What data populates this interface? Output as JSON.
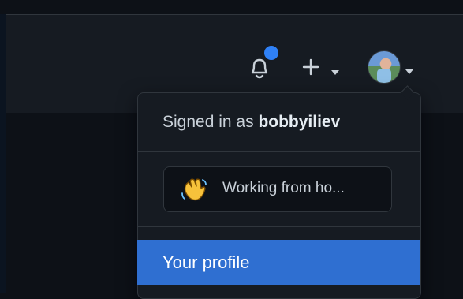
{
  "header": {
    "bell_icon": "bell-icon",
    "notification_dot_color": "#2f81f7",
    "plus_icon": "plus-icon",
    "caret_icon": "caret-down-icon",
    "avatar_label": "avatar"
  },
  "dropdown": {
    "signed_prefix": "Signed in as",
    "username": "bobbyiliev",
    "status_text": "Working from ho...",
    "status_emoji_icon": "waving-hand-icon",
    "profile_label": "Your profile",
    "highlight_color": "#2f6fd1"
  }
}
